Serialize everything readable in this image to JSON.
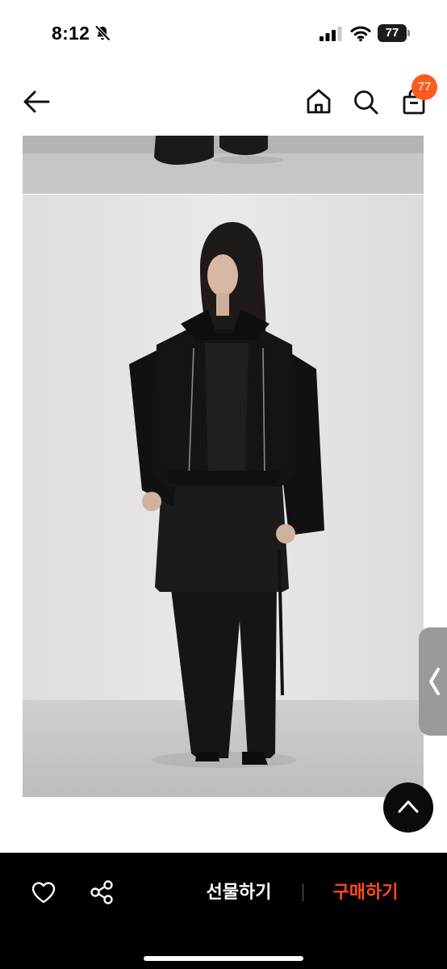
{
  "status_bar": {
    "time": "8:12",
    "battery_level": "77",
    "icons": [
      "bell-slash-icon",
      "cellular-signal-icon",
      "wifi-icon",
      "battery-icon"
    ]
  },
  "header": {
    "icons": [
      "back-arrow-icon",
      "home-icon",
      "search-icon",
      "shopping-bag-icon"
    ],
    "cart_count": "77",
    "badge_color": "#ff5a1f"
  },
  "content": {
    "images": [
      "product-photo-partial",
      "product-photo-model"
    ],
    "side_tab_icon": "chevron-left-icon",
    "scroll_top_icon": "chevron-up-icon"
  },
  "bottom_bar": {
    "icons": [
      "heart-icon",
      "share-icon"
    ],
    "gift_label": "선물하기",
    "buy_label": "구매하기",
    "buy_color": "#ff4a1c"
  }
}
